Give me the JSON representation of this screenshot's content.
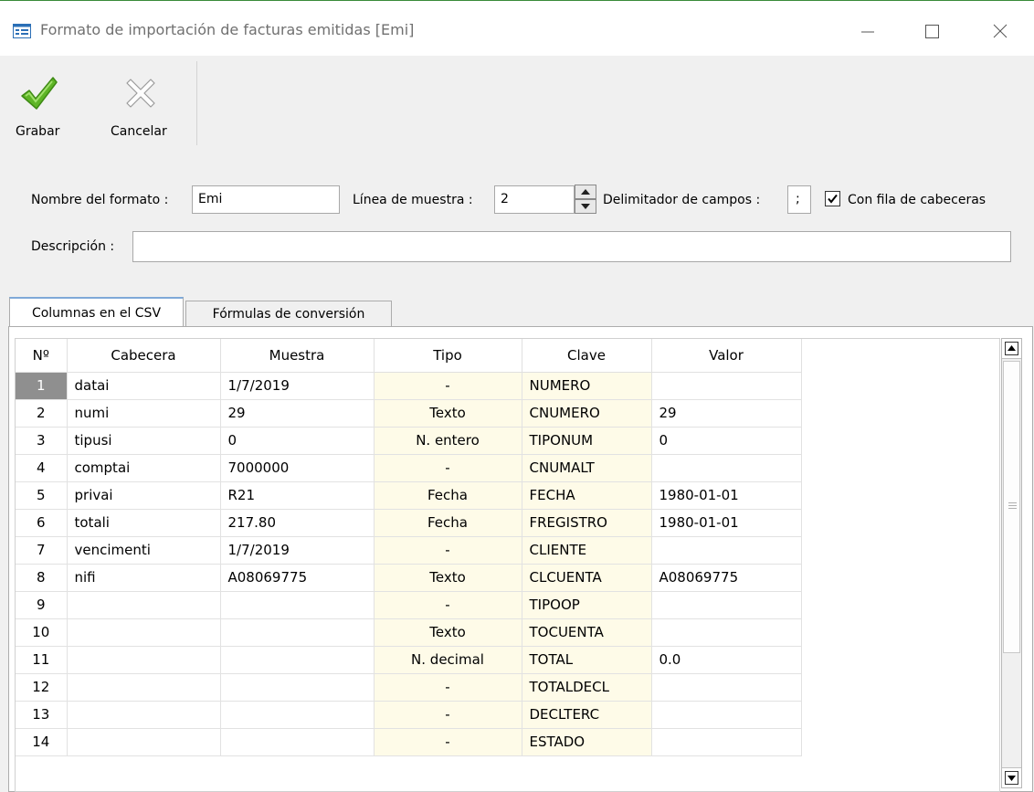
{
  "window": {
    "title": "Formato de importación de facturas emitidas [Emi]"
  },
  "toolbar": {
    "save_label": "Grabar",
    "cancel_label": "Cancelar"
  },
  "form": {
    "name_label": "Nombre del formato :",
    "name_value": "Emi",
    "sample_line_label": "Línea de muestra :",
    "sample_line_value": "2",
    "delimiter_label": "Delimitador de campos :",
    "delimiter_value": ";",
    "header_row_label": "Con fila de cabeceras",
    "header_row_checked": true,
    "description_label": "Descripción :",
    "description_value": ""
  },
  "tabs": [
    {
      "label": "Columnas en el CSV",
      "active": true
    },
    {
      "label": "Fórmulas de conversión",
      "active": false
    }
  ],
  "grid": {
    "columns": [
      "Nº",
      "Cabecera",
      "Muestra",
      "Tipo",
      "Clave",
      "Valor"
    ],
    "rows": [
      {
        "n": "1",
        "cabecera": "datai",
        "muestra": "1/7/2019",
        "tipo": "-",
        "clave": "NUMERO",
        "valor": ""
      },
      {
        "n": "2",
        "cabecera": "numi",
        "muestra": "29",
        "tipo": "Texto",
        "clave": "CNUMERO",
        "valor": "29"
      },
      {
        "n": "3",
        "cabecera": "tipusi",
        "muestra": "0",
        "tipo": "N. entero",
        "clave": "TIPONUM",
        "valor": "0"
      },
      {
        "n": "4",
        "cabecera": "comptai",
        "muestra": "7000000",
        "tipo": "-",
        "clave": "CNUMALT",
        "valor": ""
      },
      {
        "n": "5",
        "cabecera": "privai",
        "muestra": "R21",
        "tipo": "Fecha",
        "clave": "FECHA",
        "valor": "1980-01-01"
      },
      {
        "n": "6",
        "cabecera": "totali",
        "muestra": "217.80",
        "tipo": "Fecha",
        "clave": "FREGISTRO",
        "valor": "1980-01-01"
      },
      {
        "n": "7",
        "cabecera": "vencimenti",
        "muestra": "1/7/2019",
        "tipo": "-",
        "clave": "CLIENTE",
        "valor": ""
      },
      {
        "n": "8",
        "cabecera": "nifi",
        "muestra": "A08069775",
        "tipo": "Texto",
        "clave": "CLCUENTA",
        "valor": "A08069775"
      },
      {
        "n": "9",
        "cabecera": "",
        "muestra": "",
        "tipo": "-",
        "clave": "TIPOOP",
        "valor": ""
      },
      {
        "n": "10",
        "cabecera": "",
        "muestra": "",
        "tipo": "Texto",
        "clave": "TOCUENTA",
        "valor": ""
      },
      {
        "n": "11",
        "cabecera": "",
        "muestra": "",
        "tipo": "N. decimal",
        "clave": "TOTAL",
        "valor": "0.0"
      },
      {
        "n": "12",
        "cabecera": "",
        "muestra": "",
        "tipo": "-",
        "clave": "TOTALDECL",
        "valor": ""
      },
      {
        "n": "13",
        "cabecera": "",
        "muestra": "",
        "tipo": "-",
        "clave": "DECLTERC",
        "valor": ""
      },
      {
        "n": "14",
        "cabecera": "",
        "muestra": "",
        "tipo": "-",
        "clave": "ESTADO",
        "valor": ""
      }
    ],
    "selected_row": 0
  },
  "colors": {
    "accent_green": "#3a8b3a",
    "editable_cell_bg": "#fefbe8",
    "selected_row_header": "#8f8f8f"
  },
  "icons": {
    "window": "table-window-icon",
    "save": "checkmark-icon",
    "cancel": "x-cross-icon",
    "minimize": "minimize-icon",
    "maximize": "maximize-icon",
    "close": "close-icon"
  }
}
